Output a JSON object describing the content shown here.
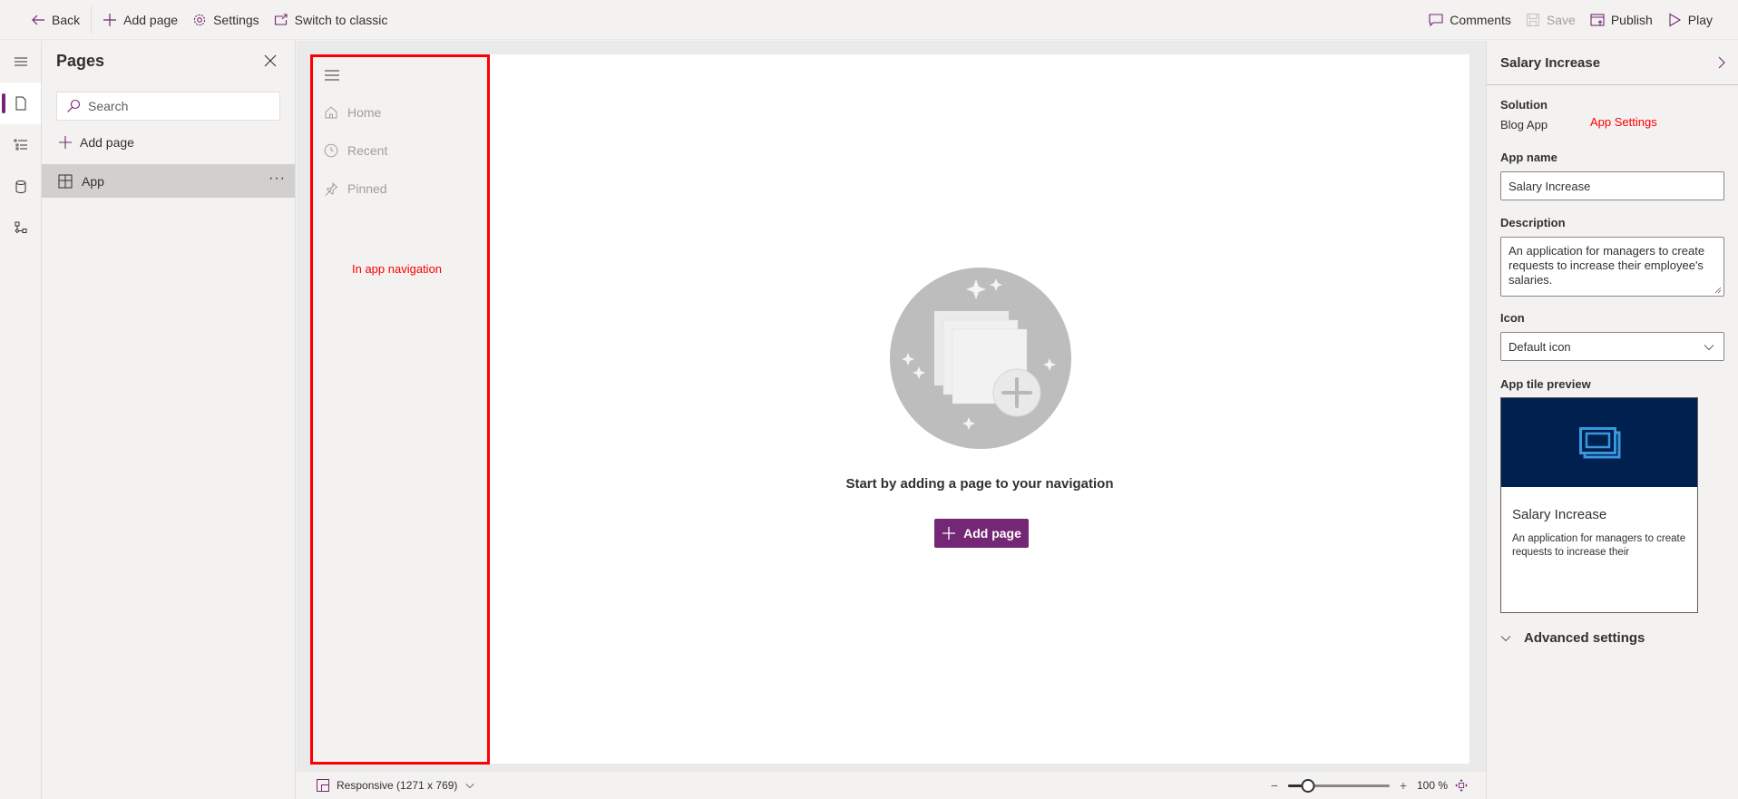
{
  "topbar": {
    "back_label": "Back",
    "add_page_label": "Add page",
    "settings_label": "Settings",
    "switch_classic_label": "Switch to classic",
    "comments_label": "Comments",
    "save_label": "Save",
    "publish_label": "Publish",
    "play_label": "Play"
  },
  "rail": {
    "items": [
      {
        "icon": "hamburger-icon"
      },
      {
        "icon": "page-icon",
        "active": true
      },
      {
        "icon": "tree-view-icon"
      },
      {
        "icon": "database-icon"
      },
      {
        "icon": "flow-icon"
      }
    ]
  },
  "pages_panel": {
    "title": "Pages",
    "search_placeholder": "Search",
    "add_page_label": "Add page",
    "items": [
      {
        "label": "App",
        "selected": true
      }
    ]
  },
  "app_nav": {
    "items": [
      {
        "label": "Home",
        "icon": "home-icon"
      },
      {
        "label": "Recent",
        "icon": "clock-icon"
      },
      {
        "label": "Pinned",
        "icon": "pin-icon"
      }
    ],
    "annotation": "In app navigation"
  },
  "canvas": {
    "empty_message": "Start by adding a page to your navigation",
    "add_page_button": "Add page"
  },
  "statusbar": {
    "layout_label": "Responsive (1271 x 769)",
    "zoom_value": "100 %",
    "zoom_slider_fraction": 0.2
  },
  "properties": {
    "title": "Salary Increase",
    "annotation": "App Settings",
    "solution_label": "Solution",
    "solution_value": "Blog App",
    "app_name_label": "App name",
    "app_name_value": "Salary Increase",
    "description_label": "Description",
    "description_value": "An application for managers to create requests to increase their employee's salaries.",
    "icon_label": "Icon",
    "icon_value": "Default icon",
    "tile_preview_label": "App tile preview",
    "tile_name": "Salary Increase",
    "tile_description": "An application for managers to create requests to increase their",
    "advanced_label": "Advanced settings"
  },
  "colors": {
    "accent": "#742774",
    "annotation": "#ff0000",
    "tile_header": "#002050",
    "tile_icon": "#3a96dd"
  }
}
